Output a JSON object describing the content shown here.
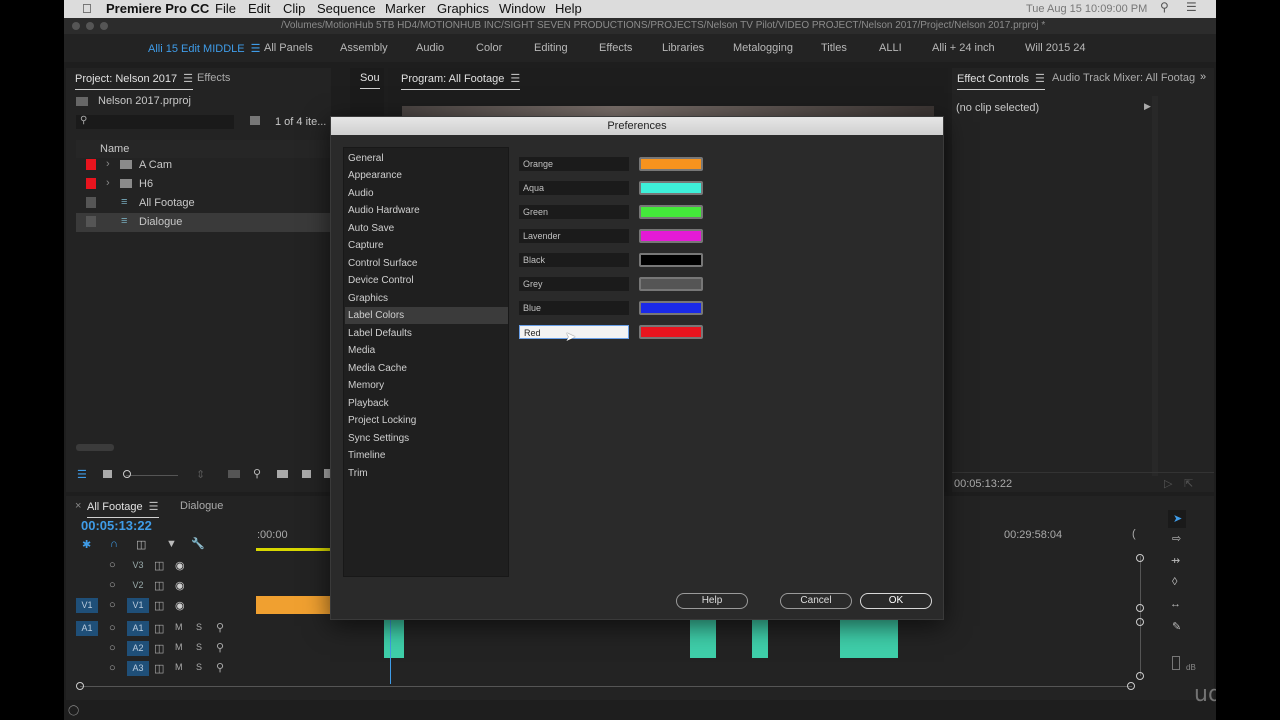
{
  "menubar": {
    "app": "Premiere Pro CC",
    "items": [
      "File",
      "Edit",
      "Clip",
      "Sequence",
      "Marker",
      "Graphics",
      "Window",
      "Help"
    ],
    "clock": "Tue Aug 15 10:09:00 PM"
  },
  "titlebar": {
    "path": "/Volumes/MotionHub 5TB HD4/MOTIONHUB INC/SIGHT SEVEN PRODUCTIONS/PROJECTS/Nelson TV Pilot/VIDEO PROJECT/Nelson 2017/Project/Nelson 2017.prproj *"
  },
  "workspaces": {
    "active": "Alli 15 Edit MIDDLE",
    "items": [
      "All Panels",
      "Assembly",
      "Audio",
      "Color",
      "Editing",
      "Effects",
      "Libraries",
      "Metalogging",
      "Titles",
      "ALLI",
      "Alli + 24 inch",
      "Will 2015 24"
    ]
  },
  "project_panel": {
    "tab": "Project: Nelson 2017",
    "tab2": "Effects",
    "file": "Nelson 2017.prproj",
    "count": "1 of 4 ite...",
    "column": "Name",
    "items": [
      {
        "name": "A Cam",
        "color": "#e8141e",
        "type": "folder"
      },
      {
        "name": "H6",
        "color": "#e8141e",
        "type": "folder"
      },
      {
        "name": "All Footage",
        "color": "#555555",
        "type": "sequence"
      },
      {
        "name": "Dialogue",
        "color": "#555555",
        "type": "sequence"
      }
    ]
  },
  "source_panel": {
    "tab": "Sou"
  },
  "program_panel": {
    "tab": "Program: All Footage"
  },
  "effect_controls": {
    "tab": "Effect Controls",
    "tab2": "Audio Track Mixer: All Footag",
    "status": "(no clip selected)",
    "timecode": "00:05:13:22"
  },
  "timeline": {
    "tab": "All Footage",
    "tab2": "Dialogue",
    "timecode": "00:05:13:22",
    "ruler_start": ":00:00",
    "ruler_mark": "00:29:58:04",
    "tracks": {
      "video": [
        "V3",
        "V2",
        "V1"
      ],
      "audio": [
        "A1",
        "A2",
        "A3"
      ],
      "source_v": "V1",
      "source_a": "A1"
    },
    "mute": "M",
    "solo": "S",
    "db": "dB"
  },
  "dialog": {
    "title": "Preferences",
    "categories": [
      "General",
      "Appearance",
      "Audio",
      "Audio Hardware",
      "Auto Save",
      "Capture",
      "Control Surface",
      "Device Control",
      "Graphics",
      "Label Colors",
      "Label Defaults",
      "Media",
      "Media Cache",
      "Memory",
      "Playback",
      "Project Locking",
      "Sync Settings",
      "Timeline",
      "Trim"
    ],
    "selected_category": "Label Colors",
    "labels": [
      {
        "name": "Orange",
        "color": "#f7931e"
      },
      {
        "name": "Aqua",
        "color": "#3ef0d9"
      },
      {
        "name": "Green",
        "color": "#44e83a"
      },
      {
        "name": "Lavender",
        "color": "#e41ad6"
      },
      {
        "name": "Black",
        "color": "#000000"
      },
      {
        "name": "Grey",
        "color": "#555555"
      },
      {
        "name": "Blue",
        "color": "#1a2ae8"
      },
      {
        "name": "Red",
        "color": "#e8141e"
      }
    ],
    "focused_label": "Red",
    "buttons": {
      "help": "Help",
      "cancel": "Cancel",
      "ok": "OK"
    }
  },
  "watermark": "udemy",
  "colors": {
    "accent": "#3f9ce8",
    "audio_clip": "#3fcfaa",
    "video_clip": "#f0a030"
  }
}
